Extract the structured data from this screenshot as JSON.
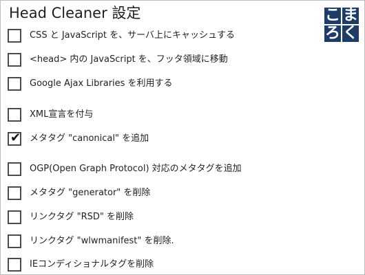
{
  "header": {
    "title": "Head Cleaner 設定"
  },
  "logo": {
    "chars": [
      "こ",
      "ま",
      "ろ",
      "く"
    ],
    "color": "#1d3c68"
  },
  "options": [
    {
      "label": "CSS と JavaScript を、サーバ上にキャッシュする",
      "checked": false
    },
    {
      "label": "<head> 内の JavaScript を、フッタ領域に移動",
      "checked": false
    },
    {
      "label": "Google Ajax Libraries を利用する",
      "checked": false
    },
    {
      "label": "XML宣言を付与",
      "checked": false
    },
    {
      "label": "メタタグ \"canonical\" を追加",
      "checked": true
    },
    {
      "label": "OGP(Open Graph Protocol) 対応のメタタグを追加",
      "checked": false
    },
    {
      "label": "メタタグ \"generator\" を削除",
      "checked": false
    },
    {
      "label": "リンクタグ \"RSD\" を削除",
      "checked": false
    },
    {
      "label": "リンクタグ \"wlwmanifest\" を削除.",
      "checked": false
    },
    {
      "label": "IEコンディショナルタグを削除",
      "checked": false
    }
  ]
}
